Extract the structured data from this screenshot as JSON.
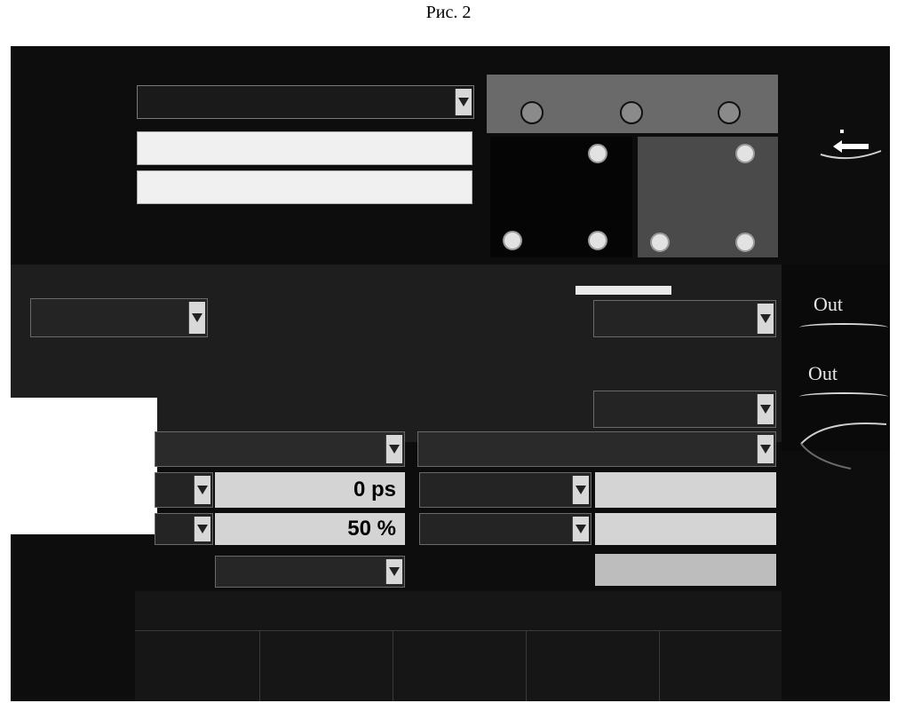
{
  "figure": {
    "caption": "Рис. 2"
  },
  "side": {
    "out_1": "Out",
    "out_2": "Out"
  },
  "fields": {
    "left_delay": "0 ps",
    "left_duty": "50 %"
  },
  "icons": {
    "dropdown": "chevron-down-icon",
    "knob": "knob-icon",
    "back": "arrow-left-icon"
  }
}
